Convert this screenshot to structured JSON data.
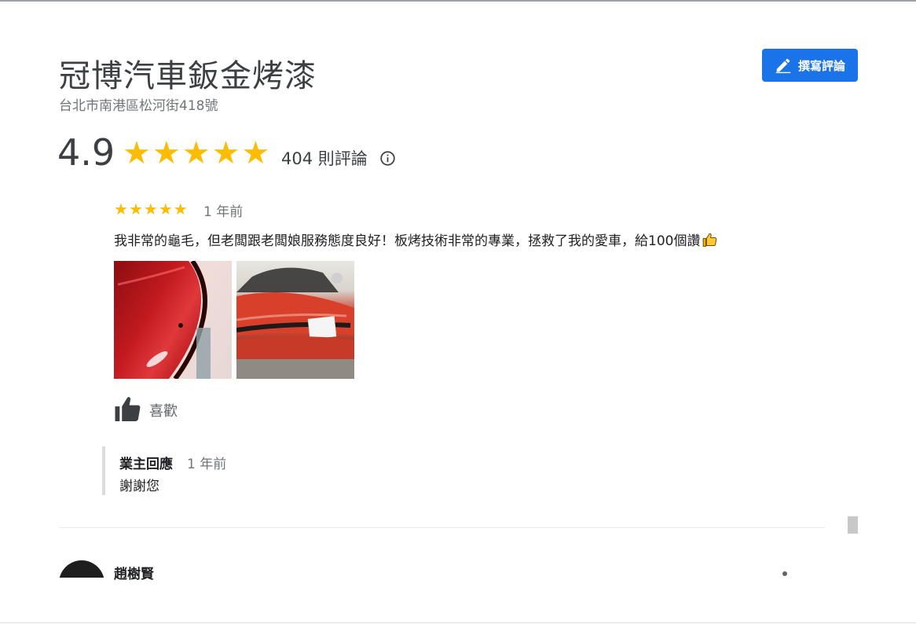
{
  "business": {
    "name": "冠博汽車鈑金烤漆",
    "address": "台北市南港區松河街418號"
  },
  "actions": {
    "write_review_label": "撰寫評論"
  },
  "summary": {
    "rating": "4.9",
    "stars": 5,
    "review_count_text": "404 則評論"
  },
  "review": {
    "stars": 5,
    "time": "1 年前",
    "text": "我非常的龜毛，但老闆跟老闆娘服務態度良好！板烤技術非常的專業，拯救了我的愛車，給100個讚",
    "emoji": "thumbs-up-emoji",
    "photos": [
      {
        "name": "review-photo-1"
      },
      {
        "name": "review-photo-2"
      }
    ],
    "like_label": "喜歡",
    "owner_reply": {
      "title": "業主回應",
      "time": "1 年前",
      "text": "謝謝您"
    }
  },
  "next_review": {
    "reviewer_name": "趙樹賢"
  },
  "colors": {
    "accent": "#1a73e8",
    "star": "#fbbc04",
    "text_primary": "#202124",
    "text_secondary": "#70757a"
  }
}
